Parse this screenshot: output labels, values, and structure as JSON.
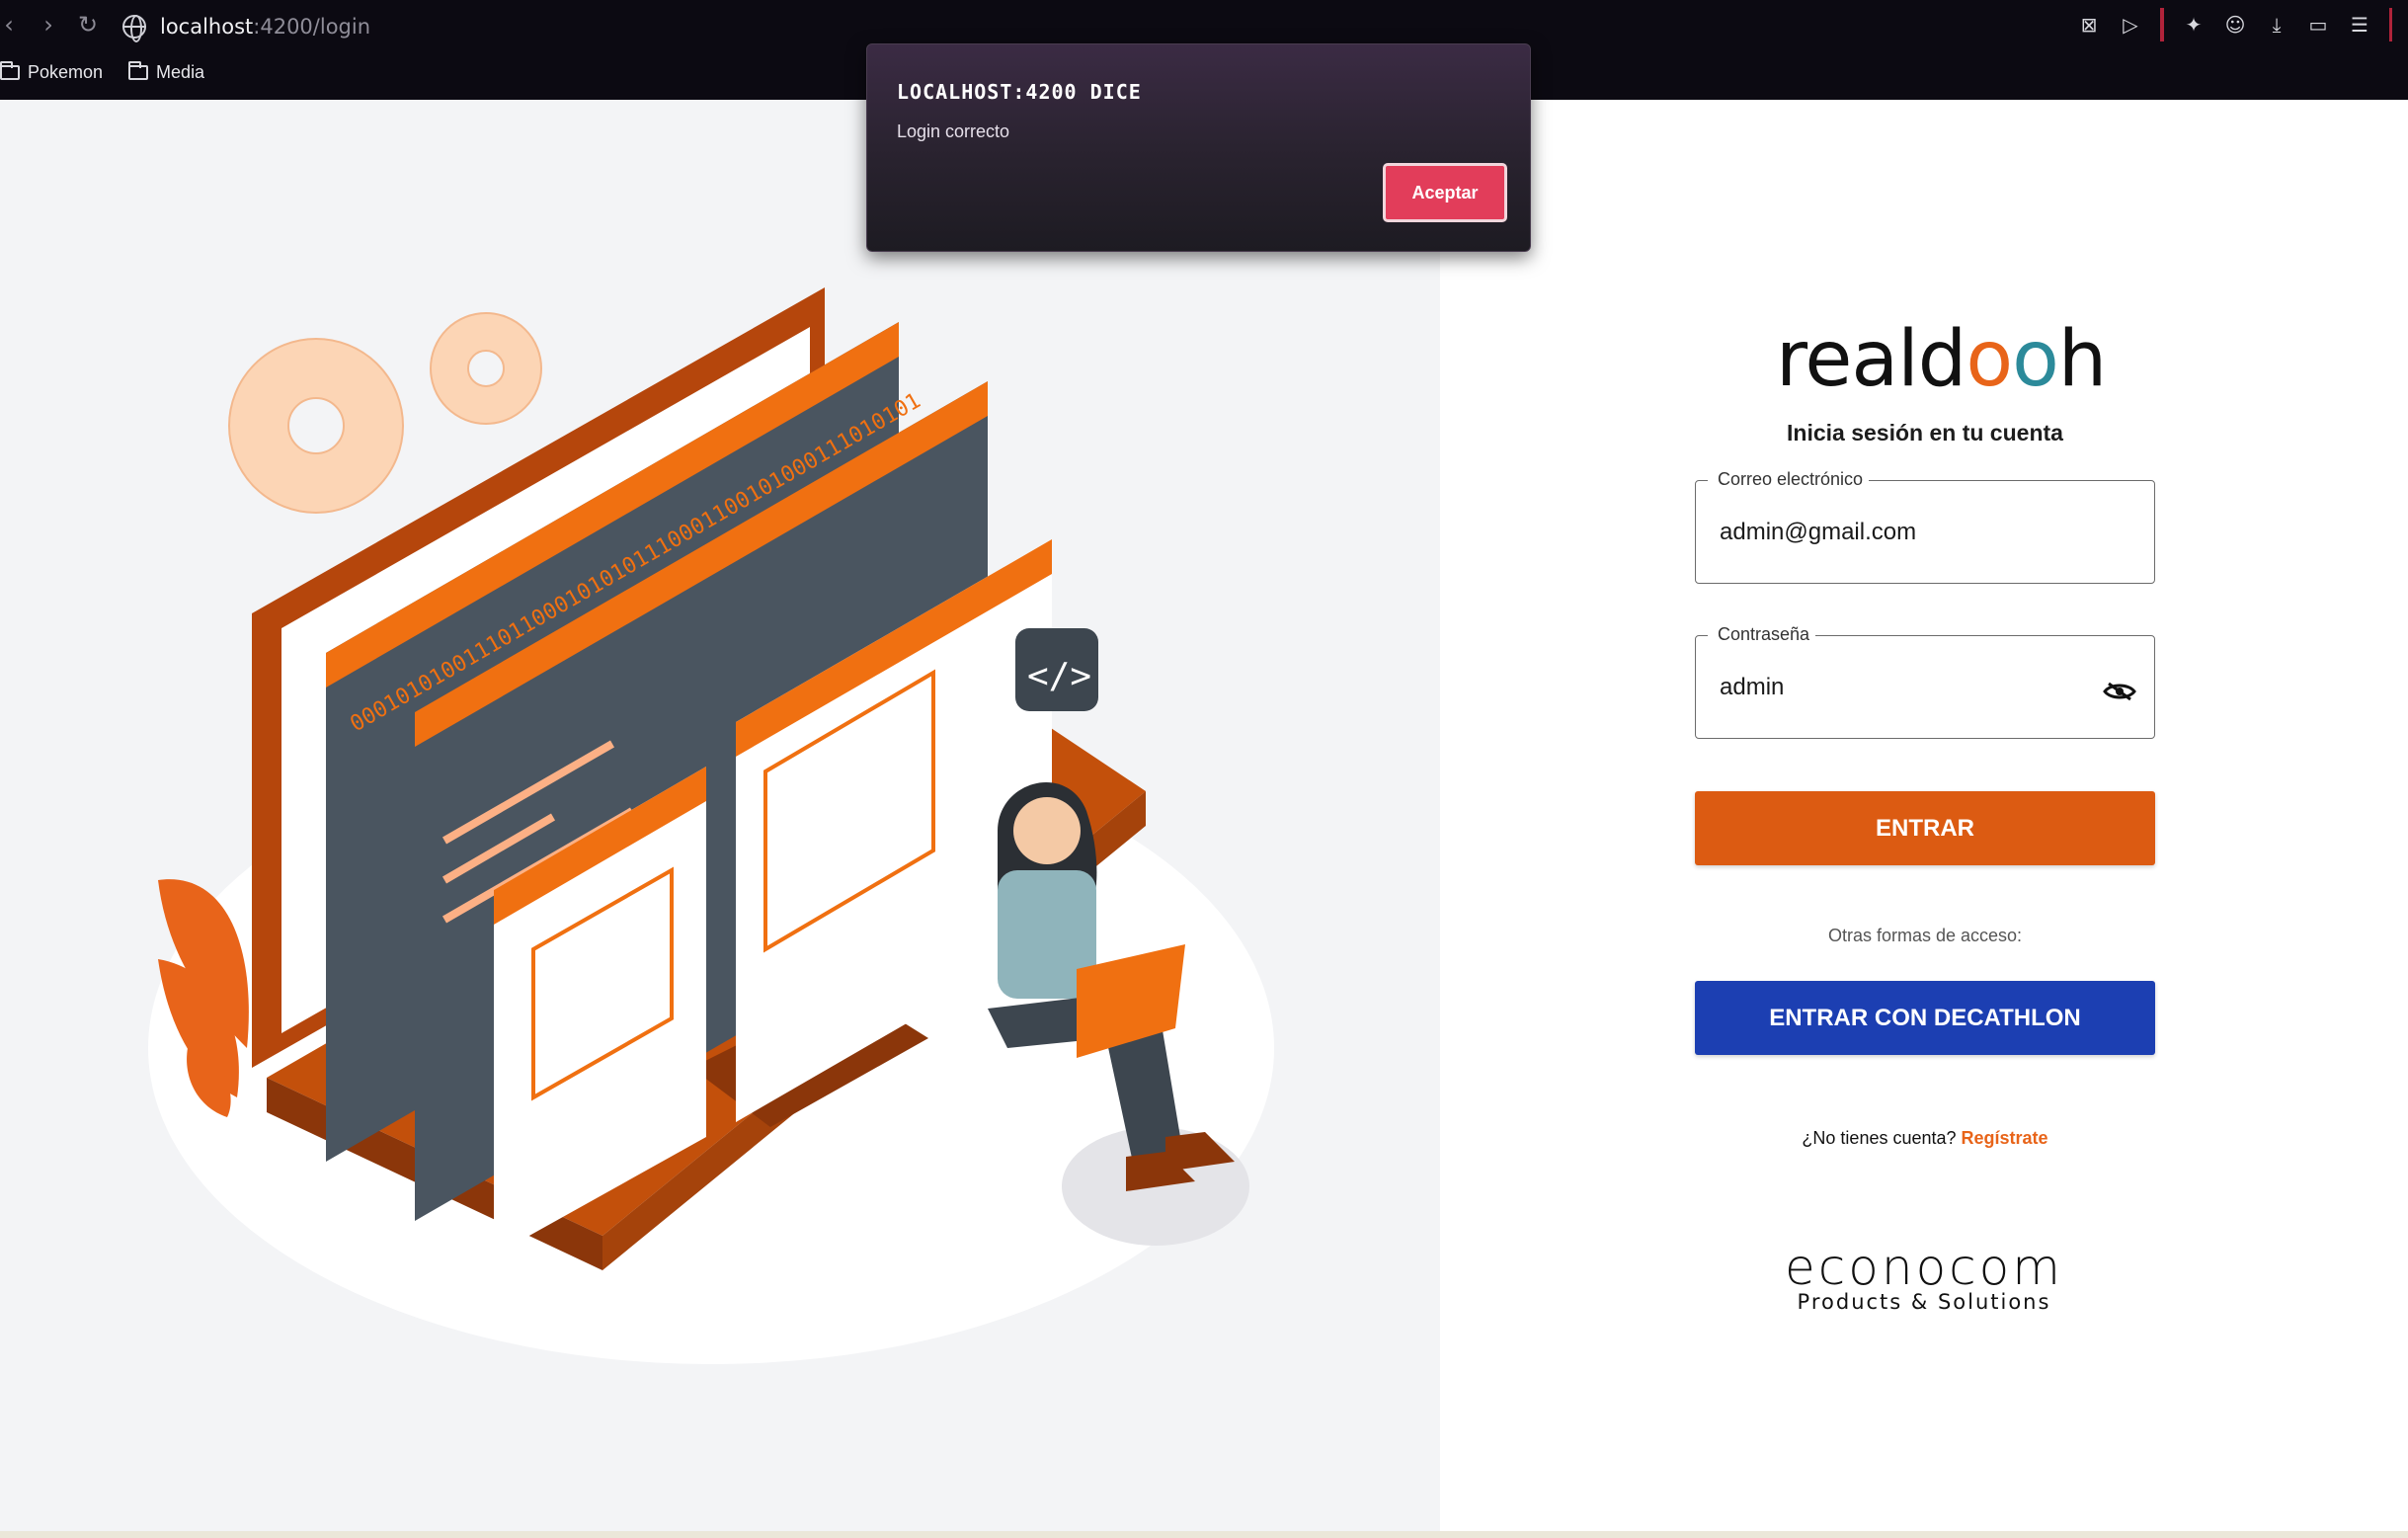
{
  "browser": {
    "url_host": "localhost",
    "url_rest": ":4200/login",
    "bookmarks": [
      "Pokemon",
      "Media"
    ]
  },
  "dialog": {
    "title": "LOCALHOST:4200 DICE",
    "message": "Login correcto",
    "accept_label": "Aceptar"
  },
  "illustration": {
    "binary_text": "00010101001110110001010101110001100101000111010101"
  },
  "login": {
    "brand_logo": "realdooh",
    "subtitle": "Inicia sesión en tu cuenta",
    "email": {
      "label": "Correo electrónico",
      "value": "admin@gmail.com"
    },
    "password": {
      "label": "Contraseña",
      "value": "admin"
    },
    "submit_label": "ENTRAR",
    "other_access": "Otras formas de acceso:",
    "decathlon_label": "ENTRAR CON DECATHLON",
    "no_account": "¿No tienes cuenta?",
    "register_link": "Regístrate",
    "footer_logo_main": "econocom",
    "footer_logo_sub": "Products & Solutions"
  },
  "colors": {
    "accent_orange": "#dc5b12",
    "decathlon_blue": "#1c3fb2",
    "dialog_button": "#e23d5a"
  }
}
